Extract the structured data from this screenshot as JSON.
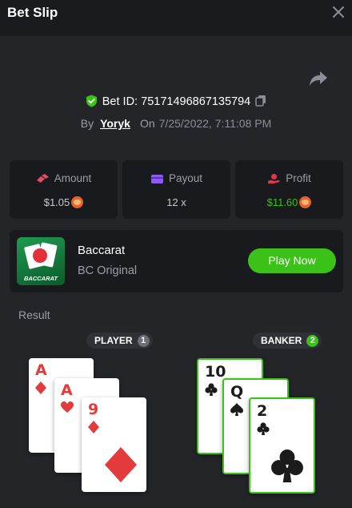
{
  "header": {
    "title": "Bet Slip"
  },
  "bet": {
    "id_label": "Bet ID:",
    "id_value": "75171496867135794",
    "by_label": "By",
    "user": "Yoryk",
    "on_label": "On",
    "date": "7/25/2022, 7:11:08 PM"
  },
  "stats": {
    "amount": {
      "label": "Amount",
      "value": "$1.05"
    },
    "payout": {
      "label": "Payout",
      "value": "12 x"
    },
    "profit": {
      "label": "Profit",
      "value": "$11.60"
    }
  },
  "game": {
    "name": "Baccarat",
    "subtitle": "BC Original",
    "thumb_text": "BACCARAT",
    "play_label": "Play Now"
  },
  "result": {
    "label": "Result",
    "player": {
      "label": "PLAYER",
      "score": "1",
      "cards": [
        {
          "rank": "A",
          "suit": "diamond"
        },
        {
          "rank": "A",
          "suit": "heart"
        },
        {
          "rank": "9",
          "suit": "diamond"
        }
      ]
    },
    "banker": {
      "label": "BANKER",
      "score": "2",
      "cards": [
        {
          "rank": "10",
          "suit": "club"
        },
        {
          "rank": "Q",
          "suit": "spade"
        },
        {
          "rank": "2",
          "suit": "club"
        }
      ]
    }
  },
  "icons": {
    "close": "close-icon",
    "share": "share-icon",
    "shield": "shield-check-icon",
    "copy": "copy-icon",
    "amount": "coins-icon",
    "payout": "wallet-icon",
    "profit": "hand-coin-icon",
    "currency": "shib-coin-icon"
  },
  "colors": {
    "accent_green": "#3bc117",
    "suit_red": "#e33b3b",
    "background": "#232529",
    "panel": "#191a1d"
  }
}
